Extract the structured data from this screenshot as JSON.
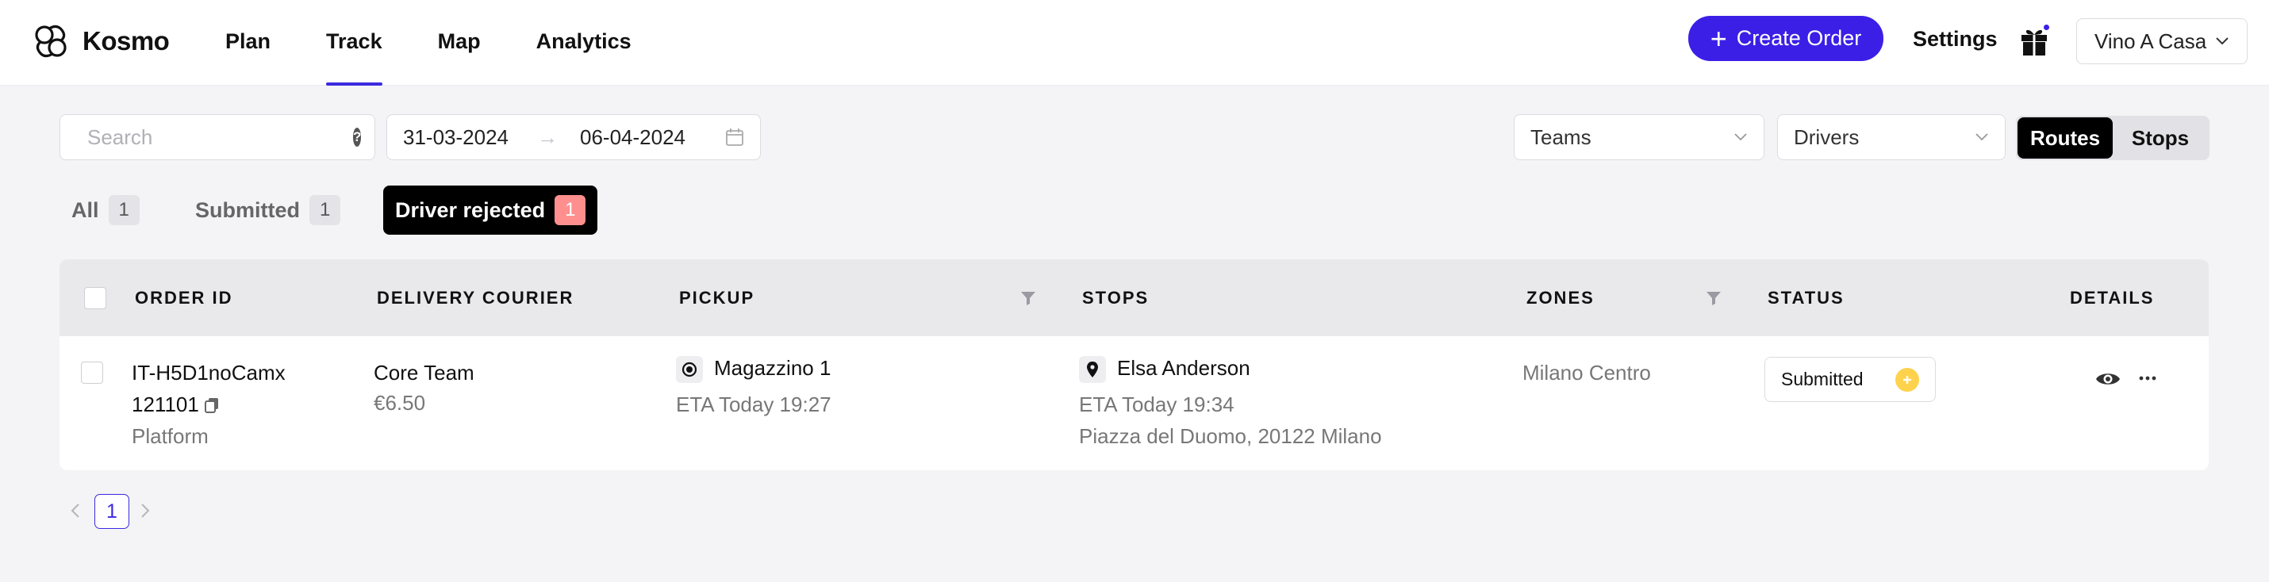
{
  "app": {
    "name": "Kosmo"
  },
  "nav": {
    "items": [
      {
        "label": "Plan"
      },
      {
        "label": "Track"
      },
      {
        "label": "Map"
      },
      {
        "label": "Analytics"
      }
    ],
    "active": "Track"
  },
  "header": {
    "create_label": "Create Order",
    "settings_label": "Settings",
    "account_label": "Vino A Casa",
    "accent_color": "#3b1fe6"
  },
  "filters": {
    "search_placeholder": "Search",
    "date_from": "31-03-2024",
    "date_to": "06-04-2024",
    "teams_label": "Teams",
    "drivers_label": "Drivers",
    "view_toggle": [
      {
        "label": "Routes",
        "active": true
      },
      {
        "label": "Stops",
        "active": false
      }
    ]
  },
  "status_tabs": [
    {
      "label": "All",
      "count": "1"
    },
    {
      "label": "Submitted",
      "count": "1"
    },
    {
      "label": "Driver rejected",
      "count": "1",
      "active": true
    }
  ],
  "table": {
    "headers": [
      "ORDER ID",
      "DELIVERY COURIER",
      "PICKUP",
      "STOPS",
      "ZONES",
      "STATUS",
      "DETAILS"
    ],
    "rows": [
      {
        "order_id": "IT-H5D1noCamx",
        "order_number": "121101",
        "source": "Platform",
        "courier": "Core Team",
        "price": "€6.50",
        "pickup_name": "Magazzino 1",
        "pickup_eta": "ETA Today 19:27",
        "stop_name": "Elsa Anderson",
        "stop_eta": "ETA Today 19:34",
        "stop_address": "Piazza del Duomo, 20122 Milano",
        "zone": "Milano Centro",
        "status": "Submitted"
      }
    ]
  },
  "pagination": {
    "current_page": "1"
  }
}
